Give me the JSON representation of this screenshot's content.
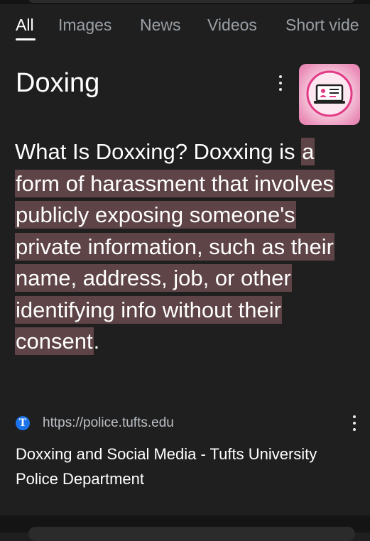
{
  "tabs": [
    {
      "label": "All",
      "active": true
    },
    {
      "label": "Images"
    },
    {
      "label": "News"
    },
    {
      "label": "Videos"
    },
    {
      "label": "Short vide"
    }
  ],
  "knowledge_panel": {
    "title": "Doxing",
    "menu_icon": "more-vert-icon",
    "thumbnail_icon": "laptop-profile-illustration-icon"
  },
  "featured_snippet": {
    "text_before": "What Is Doxxing? Doxxing is ",
    "highlighted": "a form of harassment that involves publicly exposing someone's private information, such as their name, address, job, or other identifying info without their consent",
    "text_after": "."
  },
  "source": {
    "favicon_letter": "T",
    "url": "https://police.tufts.edu",
    "title": "Doxxing and Social Media - Tufts University Police Department",
    "menu_icon": "more-vert-icon"
  },
  "colors": {
    "background": "#1f1f1f",
    "highlight": "#5e4447",
    "favicon": "#1a73e8"
  }
}
